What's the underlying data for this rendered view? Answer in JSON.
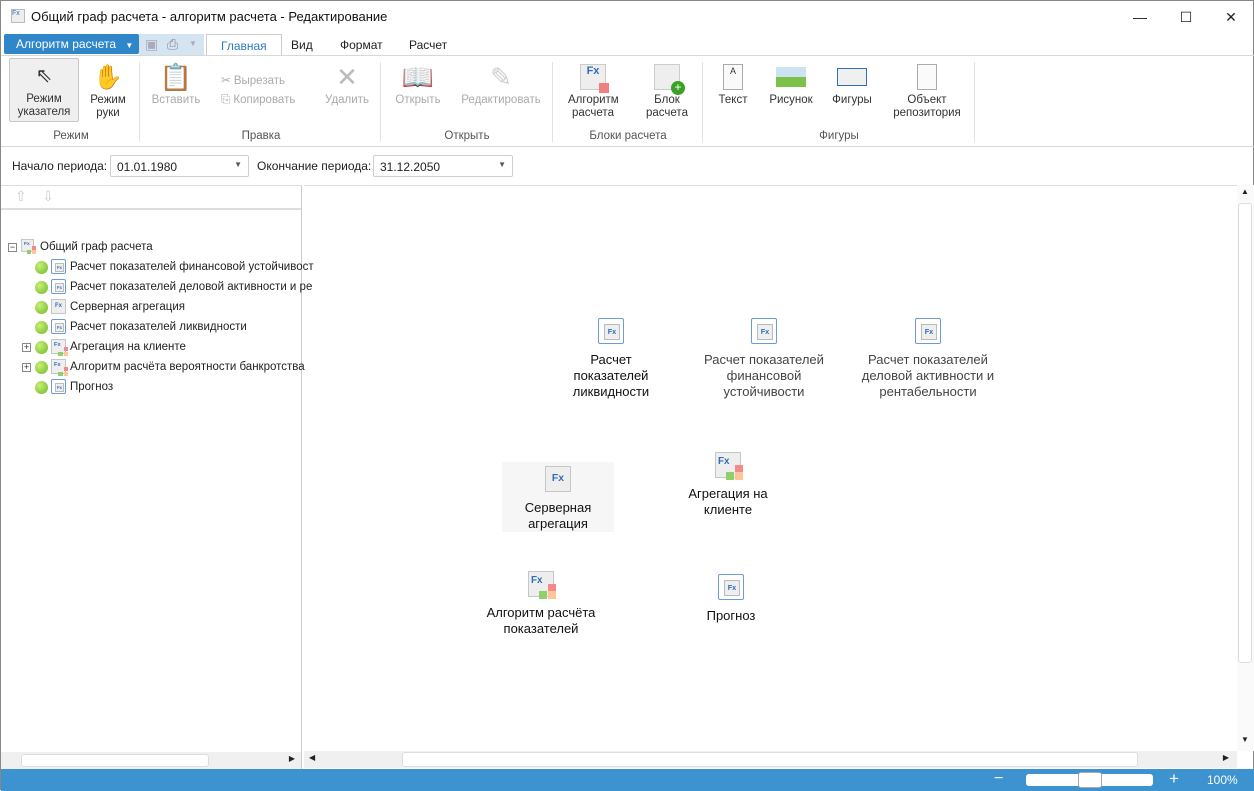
{
  "window": {
    "title": "Общий граф расчета - алгоритм расчета - Редактирование",
    "minimize": "—",
    "maximize": "☐",
    "close": "✕"
  },
  "app_menu": {
    "label": "Алгоритм расчета"
  },
  "tabs": [
    {
      "label": "Главная",
      "active": true
    },
    {
      "label": "Вид"
    },
    {
      "label": "Формат"
    },
    {
      "label": "Расчет"
    }
  ],
  "ribbon": {
    "mode": {
      "group": "Режим",
      "pointer": "Режим указателя",
      "hand": "Режим руки"
    },
    "edit": {
      "group": "Правка",
      "paste": "Вставить",
      "cut": "Вырезать",
      "copy": "Копировать",
      "delete": "Удалить"
    },
    "open": {
      "group": "Открыть",
      "open": "Открыть",
      "edit": "Редактировать"
    },
    "blocks": {
      "group": "Блоки расчета",
      "algorithm": "Алгоритм расчета",
      "block": "Блок расчета"
    },
    "shapes": {
      "group": "Фигуры",
      "text": "Текст",
      "picture": "Рисунок",
      "figures": "Фигуры",
      "repo": "Объект репозитория"
    }
  },
  "period": {
    "start_label": "Начало периода:",
    "start_value": "01.01.1980",
    "end_label": "Окончание периода:",
    "end_value": "31.12.2050"
  },
  "tree": {
    "root": "Общий граф расчета",
    "items": [
      {
        "label": "Расчет показателей финансовой устойчивост",
        "icon": "loop-fx"
      },
      {
        "label": "Расчет показателей деловой активности и ре",
        "icon": "loop-fx"
      },
      {
        "label": "Серверная агрегация",
        "icon": "fx"
      },
      {
        "label": "Расчет показателей ликвидности",
        "icon": "loop-fx"
      },
      {
        "label": "Агрегация на клиенте",
        "icon": "fx-multi",
        "expandable": true
      },
      {
        "label": "Алгоритм расчёта вероятности банкротства",
        "icon": "fx-multi",
        "expandable": true
      },
      {
        "label": "Прогноз",
        "icon": "loop-fx"
      }
    ]
  },
  "canvas": {
    "nodes": [
      {
        "label": "Расчет показателей ликвидности",
        "icon": "loop-fx"
      },
      {
        "label": "Расчет показателей финансовой устойчивости",
        "icon": "loop-fx"
      },
      {
        "label": "Расчет показателей деловой активности и рентабельности",
        "icon": "loop-fx"
      },
      {
        "label": "Серверная агрегация",
        "icon": "fx",
        "selected": true
      },
      {
        "label": "Агрегация на клиенте",
        "icon": "fx-multi"
      },
      {
        "label": "Алгоритм расчёта показателей",
        "icon": "fx-multi"
      },
      {
        "label": "Прогноз",
        "icon": "loop-fx"
      }
    ]
  },
  "status": {
    "zoom_out": "−",
    "zoom_in": "+",
    "zoom": "100%",
    "zoom_fraction": 0.5
  },
  "colors": {
    "accent": "#2f86c8",
    "status_bar": "#3c93cf"
  }
}
